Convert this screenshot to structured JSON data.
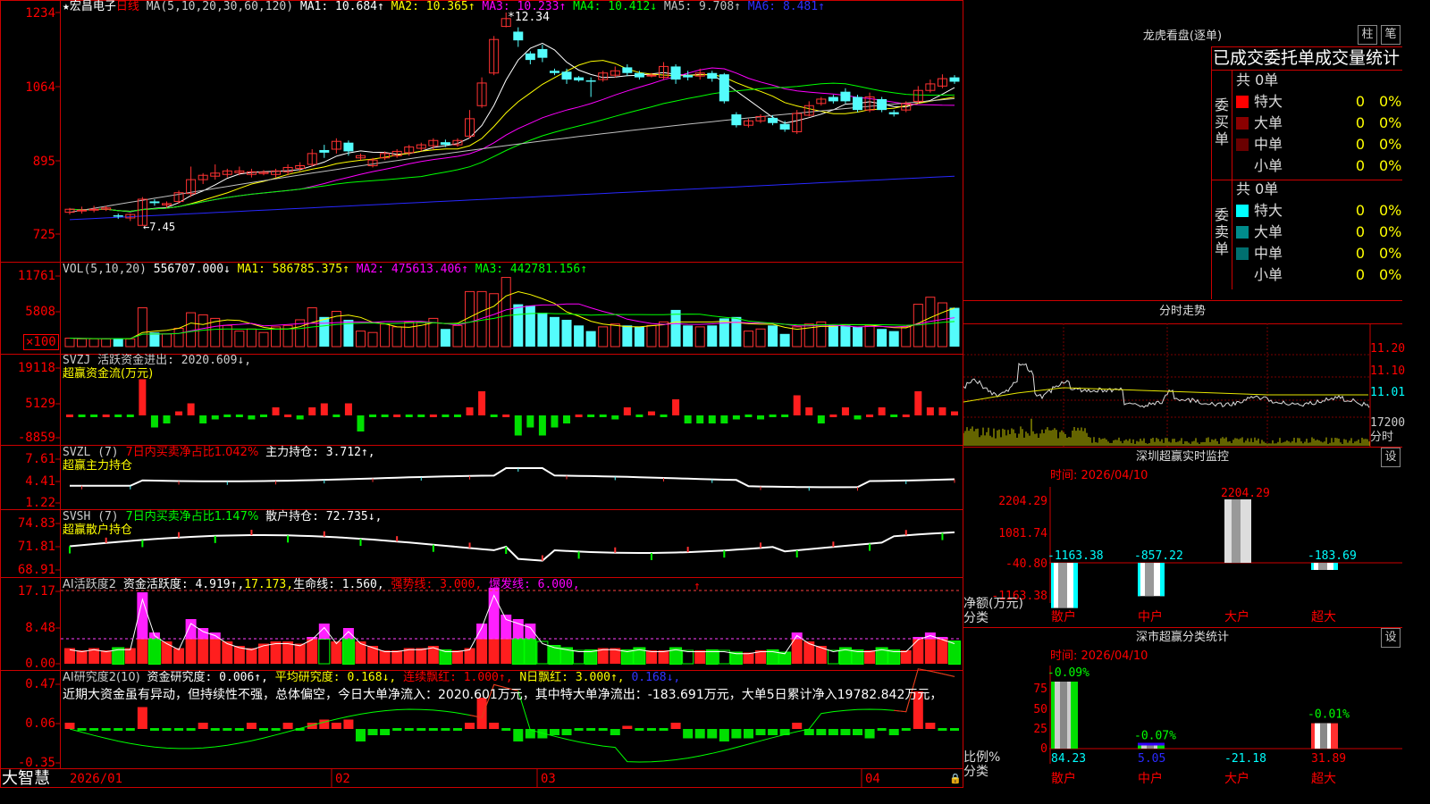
{
  "header": {
    "name": "宏昌电子",
    "period": "日线",
    "ma_title": "MA(5,10,20,30,60,120)",
    "ma": [
      {
        "label": "MA1:",
        "value": "10.684↑",
        "color": "#ffffff"
      },
      {
        "label": "MA2:",
        "value": "10.365↑",
        "color": "#ffff00"
      },
      {
        "label": "MA3:",
        "value": "10.233↑",
        "color": "#ff00ff"
      },
      {
        "label": "MA4:",
        "value": "10.412↓",
        "color": "#00ff00"
      },
      {
        "label": "MA5:",
        "value": "9.708↑",
        "color": "#c0c0c0"
      },
      {
        "label": "MA6:",
        "value": "8.481↑",
        "color": "#3030ff"
      }
    ],
    "high_mark": "12.34",
    "low_mark": "7.45"
  },
  "price_axis": [
    "1234",
    "1064",
    "895",
    "725"
  ],
  "vol": {
    "title": "VOL(5,10,20)",
    "value": "556707.000↓",
    "ma1": "MA1: 586785.375↑",
    "ma2": "MA2: 475613.406↑",
    "ma3": "MA3: 442781.156↑",
    "axis": [
      "11761",
      "5808"
    ],
    "unit": "×100"
  },
  "svzj": {
    "title": "SVZJ  活跃资金进出: 2020.609↓,",
    "sub": "超赢资金流(万元)",
    "axis": [
      "19118",
      "5129",
      "-8859"
    ]
  },
  "svzl": {
    "title": "SVZL (7)",
    "ratio": "7日内买卖净占比1.042%",
    "hold": "主力持仓: 3.712↑,",
    "sub": "超赢主力持仓",
    "axis": [
      "7.61",
      "4.41",
      "1.22"
    ]
  },
  "svsh": {
    "title": "SVSH (7)",
    "ratio": "7日内买卖净占比1.147%",
    "hold": "散户持仓: 72.735↓,",
    "sub": "超赢散户持仓",
    "axis": [
      "74.83",
      "71.81",
      "68.91"
    ]
  },
  "ai1": {
    "title": "AI活跃度2",
    "active": "资金活跃度: 4.919↑,",
    "v2": "17.173,",
    "life": "生命线: 1.560,",
    "strong": "强势线: 3.000,",
    "burst": "爆发线: 6.000,",
    "axis": [
      "17.17",
      "8.48",
      "0.00"
    ]
  },
  "ai2": {
    "title": "AI研究度2(10)",
    "depth": "资金研究度: 0.006↑,",
    "avg": "平均研究度: 0.168↓,",
    "cont": "连续飘红: 1.000↑,",
    "nday": "N日飘红: 3.000↑,",
    "last": "0.168↓,",
    "comment": "近期大资金虽有异动，但持续性不强，总体偏空，今日大单净流入：2020.601万元，其中特大单净流出：-183.691万元，大单5日累计净入19782.842万元，",
    "axis": [
      "0.47",
      "0.06",
      "-0.35"
    ]
  },
  "dates": [
    "2026/01",
    "02",
    "03",
    "04"
  ],
  "footer_brand": "大智慧",
  "lhb": {
    "title": "龙虎看盘(逐单)",
    "btn1": "柱",
    "btn2": "笔",
    "header": "已成交委托单成交量统计",
    "buy": {
      "label": "委买单",
      "total": "共 0单",
      "rows": [
        {
          "name": "特大",
          "num": "0",
          "pct": "0%",
          "color": "#ff0000"
        },
        {
          "name": "大单",
          "num": "0",
          "pct": "0%",
          "color": "#8b0000"
        },
        {
          "name": "中单",
          "num": "0",
          "pct": "0%",
          "color": "#6a0000"
        },
        {
          "name": "小单",
          "num": "0",
          "pct": "0%",
          "color": ""
        }
      ]
    },
    "sell": {
      "label": "委卖单",
      "total": "共 0单",
      "rows": [
        {
          "name": "特大",
          "num": "0",
          "pct": "0%",
          "color": "#00ffff"
        },
        {
          "name": "大单",
          "num": "0",
          "pct": "0%",
          "color": "#008b8b"
        },
        {
          "name": "中单",
          "num": "0",
          "pct": "0%",
          "color": "#006f6f"
        },
        {
          "name": "小单",
          "num": "0",
          "pct": "0%",
          "color": ""
        }
      ]
    }
  },
  "intraday": {
    "title": "分时走势",
    "axis": [
      "11.20",
      "11.10",
      "11.01",
      "17200",
      "分时"
    ]
  },
  "sz_monitor": {
    "title": "深圳超赢实时监控",
    "btn": "设",
    "time": "时间: 2026/04/10",
    "axis": [
      "2204.29",
      "1081.74",
      "-40.80",
      "-1163.38"
    ],
    "y_label": "净额(万元)",
    "x_label": "分类",
    "cats": [
      "散户",
      "中户",
      "大户",
      "超大"
    ],
    "values": [
      -1163.38,
      -857.22,
      2204.29,
      -183.69
    ],
    "value_labels": [
      "-1163.38",
      "-857.22",
      "2204.29",
      "-183.69"
    ]
  },
  "sz_stats": {
    "title": "深市超赢分类统计",
    "btn": "设",
    "time": "时间: 2026/04/10",
    "axis": [
      "75",
      "50",
      "25",
      "0"
    ],
    "y_label": "比例%",
    "x_label": "分类",
    "cats": [
      "散户",
      "中户",
      "大户",
      "超大"
    ],
    "top_labels": [
      "-0.09%",
      "-0.07%",
      "",
      "-0.01%"
    ],
    "values": [
      84.23,
      5.05,
      -21.18,
      31.89
    ],
    "value_labels": [
      "84.23",
      "5.05",
      "-21.18",
      "31.89"
    ]
  },
  "chart_data": {
    "type": "candlestick",
    "symbol": "宏昌电子",
    "period": "日线",
    "candles": [
      [
        7.75,
        7.82,
        7.7,
        7.85
      ],
      [
        7.78,
        7.8,
        7.72,
        7.88
      ],
      [
        7.8,
        7.82,
        7.75,
        7.9
      ],
      [
        7.82,
        7.85,
        7.78,
        7.9
      ],
      [
        7.68,
        7.65,
        7.6,
        7.72
      ],
      [
        7.62,
        7.7,
        7.55,
        7.72
      ],
      [
        7.45,
        8.05,
        7.45,
        8.1
      ],
      [
        8.0,
        7.96,
        7.9,
        8.05
      ],
      [
        7.92,
        7.95,
        7.85,
        8.0
      ],
      [
        8.0,
        8.2,
        7.95,
        8.25
      ],
      [
        8.18,
        8.5,
        8.1,
        8.8
      ],
      [
        8.5,
        8.6,
        8.4,
        8.65
      ],
      [
        8.58,
        8.65,
        8.5,
        8.85
      ],
      [
        8.62,
        8.7,
        8.55,
        8.75
      ],
      [
        8.66,
        8.7,
        8.6,
        8.8
      ],
      [
        8.62,
        8.68,
        8.55,
        8.75
      ],
      [
        8.64,
        8.67,
        8.6,
        8.72
      ],
      [
        8.62,
        8.7,
        8.55,
        8.75
      ],
      [
        8.68,
        8.78,
        8.6,
        8.85
      ],
      [
        8.76,
        8.82,
        8.7,
        8.9
      ],
      [
        8.85,
        9.1,
        8.8,
        9.2
      ],
      [
        9.18,
        9.12,
        9.0,
        9.3
      ],
      [
        9.2,
        9.38,
        9.1,
        9.45
      ],
      [
        9.35,
        9.15,
        9.05,
        9.4
      ],
      [
        9.0,
        9.05,
        8.95,
        9.1
      ],
      [
        8.82,
        8.95,
        8.78,
        9.0
      ],
      [
        9.0,
        9.1,
        8.95,
        9.15
      ],
      [
        9.05,
        9.15,
        9.0,
        9.2
      ],
      [
        9.12,
        9.25,
        9.05,
        9.3
      ],
      [
        9.22,
        9.3,
        9.15,
        9.35
      ],
      [
        9.28,
        9.4,
        9.2,
        9.45
      ],
      [
        9.36,
        9.3,
        9.25,
        9.42
      ],
      [
        9.3,
        9.4,
        9.25,
        9.45
      ],
      [
        9.5,
        9.9,
        9.45,
        10.1
      ],
      [
        10.2,
        10.72,
        10.15,
        10.85
      ],
      [
        10.95,
        11.72,
        10.9,
        11.8
      ],
      [
        12.02,
        12.2,
        12.0,
        12.34
      ],
      [
        11.9,
        11.7,
        11.55,
        12.0
      ],
      [
        11.4,
        11.25,
        11.15,
        11.45
      ],
      [
        11.5,
        11.3,
        11.2,
        11.6
      ],
      [
        11.0,
        10.95,
        10.9,
        11.05
      ],
      [
        10.98,
        10.8,
        10.7,
        11.05
      ],
      [
        10.85,
        10.78,
        10.75,
        10.88
      ],
      [
        10.78,
        10.75,
        10.4,
        10.85
      ],
      [
        10.8,
        10.95,
        10.75,
        11.0
      ],
      [
        10.9,
        11.0,
        10.85,
        11.1
      ],
      [
        11.08,
        10.95,
        10.88,
        11.15
      ],
      [
        10.95,
        10.85,
        10.8,
        11.0
      ],
      [
        10.88,
        10.9,
        10.85,
        10.95
      ],
      [
        10.85,
        11.1,
        10.8,
        11.2
      ],
      [
        11.1,
        10.8,
        10.7,
        11.15
      ],
      [
        10.9,
        10.85,
        10.78,
        11.0
      ],
      [
        10.88,
        10.95,
        10.8,
        11.05
      ],
      [
        10.95,
        10.82,
        10.75,
        11.0
      ],
      [
        10.92,
        10.3,
        10.25,
        10.95
      ],
      [
        10.0,
        9.75,
        9.7,
        10.05
      ],
      [
        9.75,
        9.85,
        9.7,
        9.9
      ],
      [
        9.85,
        9.95,
        9.8,
        10.0
      ],
      [
        9.92,
        9.8,
        9.75,
        9.98
      ],
      [
        9.78,
        9.65,
        9.6,
        9.85
      ],
      [
        9.6,
        10.02,
        9.55,
        10.1
      ],
      [
        9.98,
        10.2,
        9.95,
        10.3
      ],
      [
        10.25,
        10.35,
        10.2,
        10.4
      ],
      [
        10.4,
        10.3,
        10.25,
        10.45
      ],
      [
        10.52,
        10.3,
        10.25,
        10.6
      ],
      [
        10.4,
        10.1,
        10.05,
        10.45
      ],
      [
        10.1,
        10.4,
        10.05,
        10.5
      ],
      [
        10.35,
        10.1,
        10.05,
        10.4
      ],
      [
        10.05,
        10.0,
        9.95,
        10.1
      ],
      [
        10.1,
        10.25,
        10.05,
        10.3
      ],
      [
        10.3,
        10.55,
        10.25,
        10.65
      ],
      [
        10.55,
        10.7,
        10.5,
        10.8
      ],
      [
        10.65,
        10.82,
        10.6,
        10.92
      ],
      [
        10.85,
        10.75,
        10.7,
        10.9
      ]
    ],
    "ma_labels": [
      "MA1 10.684",
      "MA2 10.365",
      "MA3 10.233",
      "MA4 10.412",
      "MA5 9.708",
      "MA6 8.481"
    ],
    "price_range": [
      7.25,
      12.34
    ],
    "x_ticks": [
      "2026/01",
      "02",
      "03",
      "04"
    ]
  }
}
